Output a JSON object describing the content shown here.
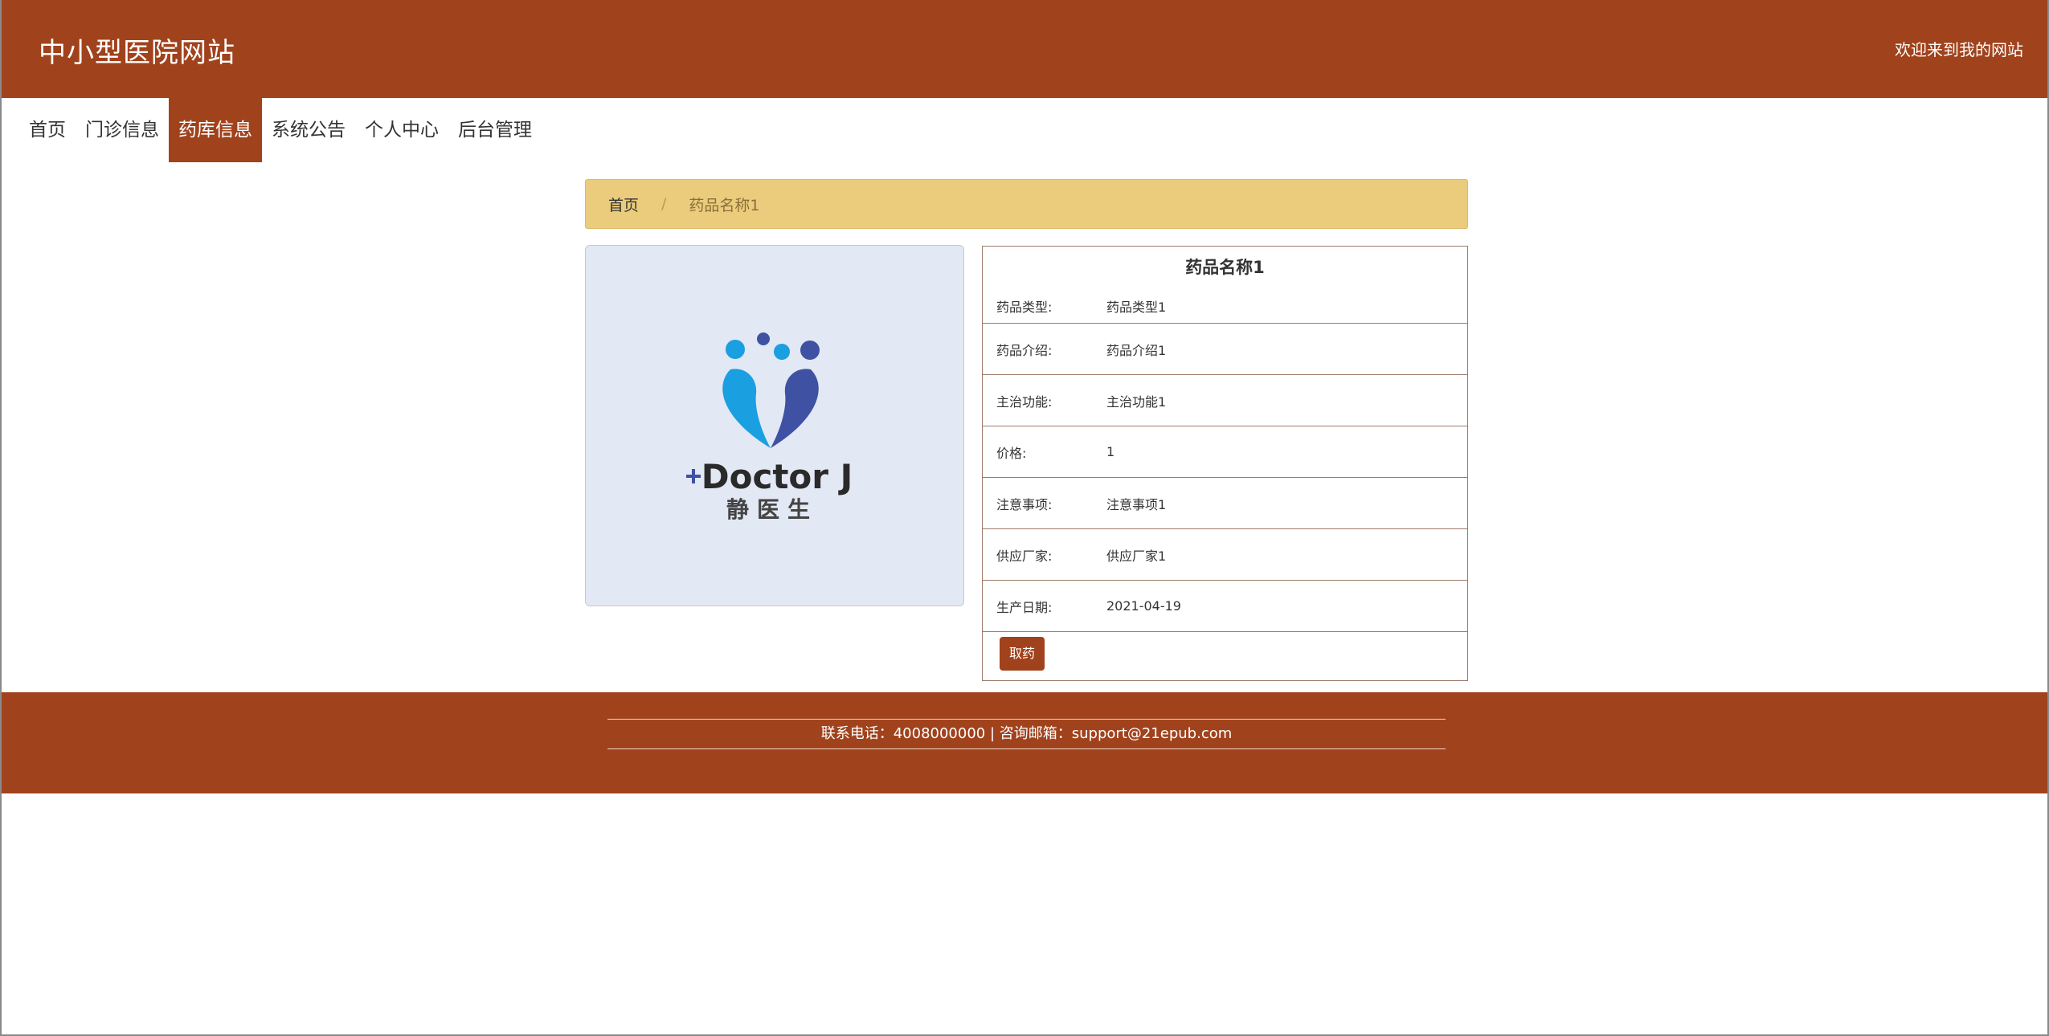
{
  "header": {
    "site_title": "中小型医院网站",
    "welcome": "欢迎来到我的网站"
  },
  "nav": {
    "items": [
      {
        "label": "首页"
      },
      {
        "label": "门诊信息"
      },
      {
        "label": "药库信息",
        "active": true
      },
      {
        "label": "系统公告"
      },
      {
        "label": "个人中心"
      },
      {
        "label": "后台管理"
      }
    ]
  },
  "breadcrumb": {
    "home": "首页",
    "separator": "/",
    "current": "药品名称1"
  },
  "image": {
    "brand_en": "Doctor J",
    "brand_cn": "静医生"
  },
  "detail": {
    "title": "药品名称1",
    "rows": [
      {
        "label": "药品类型:",
        "value": "药品类型1"
      },
      {
        "label": "药品介绍:",
        "value": "药品介绍1"
      },
      {
        "label": "主治功能:",
        "value": "主治功能1"
      },
      {
        "label": "价格:",
        "value": "1"
      },
      {
        "label": "注意事项:",
        "value": "注意事项1"
      },
      {
        "label": "供应厂家:",
        "value": "供应厂家1"
      },
      {
        "label": "生产日期:",
        "value": "2021-04-19"
      }
    ],
    "action_label": "取药"
  },
  "footer": {
    "contact": "联系电话：4008000000 | 咨询邮箱：support@21epub.com"
  },
  "colors": {
    "primary": "#a0421c",
    "breadcrumb_bg": "#ebcc7c",
    "image_bg": "#e2e8f4",
    "logo_blue": "#1a9fe0",
    "logo_indigo": "#3f51a3"
  }
}
